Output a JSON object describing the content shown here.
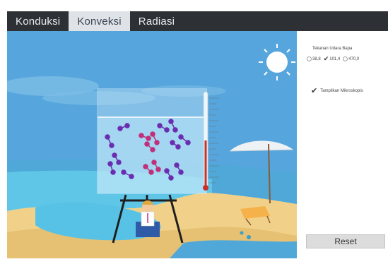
{
  "tabs": [
    {
      "label": "Konduksi",
      "active": false
    },
    {
      "label": "Konveksi",
      "active": true
    },
    {
      "label": "Radiasi",
      "active": false
    }
  ],
  "panel": {
    "title": "Tekanan Udara Bapa",
    "options": [
      {
        "label": "38,8",
        "selected": false
      },
      {
        "label": "101,4",
        "selected": true
      },
      {
        "label": "470,0",
        "selected": false
      }
    ],
    "microscope_label": "Tampilkan Mikroskopis",
    "microscope_checked": true,
    "reset_label": "Reset"
  },
  "colors": {
    "tabbar": "#2d3035",
    "active_tab": "#dfe3e8",
    "sky": "#56a6dd",
    "sand": "#f1d189",
    "sea": "#5fc6e8",
    "molecule": "#6a2db0",
    "molecule_hot": "#c0307a"
  },
  "icons": [
    "sun-icon",
    "umbrella-icon",
    "thermometer-icon",
    "beach-chair-icon",
    "person-icon"
  ]
}
